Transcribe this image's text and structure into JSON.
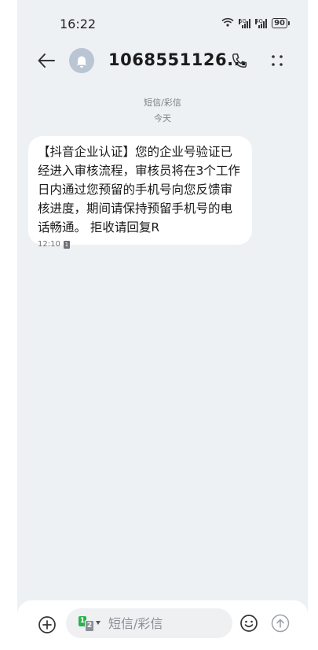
{
  "status_bar": {
    "time": "16:22",
    "network_1": "5G",
    "network_2": "4G",
    "battery": "90"
  },
  "header": {
    "contact": "1068551126...",
    "icons": [
      "back-arrow-icon",
      "bell-avatar-icon",
      "phone-icon",
      "more-dots-icon"
    ]
  },
  "thread": {
    "channel_label": "短信/彩信",
    "date_label": "今天",
    "messages": [
      {
        "text": "【抖音企业认证】您的企业号验证已经进入审核流程，审核员将在3个工作日内通过您预留的手机号向您反馈审核进度，期间请保持预留手机号的电话畅通。 拒收请回复R",
        "time": "12:10",
        "sim": "1"
      }
    ]
  },
  "compose": {
    "placeholder": "短信/彩信",
    "sim_primary": "1",
    "sim_secondary": "2",
    "icons": [
      "plus-circle-icon",
      "sim-switch-icon",
      "emoji-icon",
      "send-arrow-icon"
    ]
  },
  "colors": {
    "background": "#eef1f3",
    "bubble": "#ffffff",
    "sim1": "#2bb24c",
    "avatar": "#b9c5d3"
  }
}
